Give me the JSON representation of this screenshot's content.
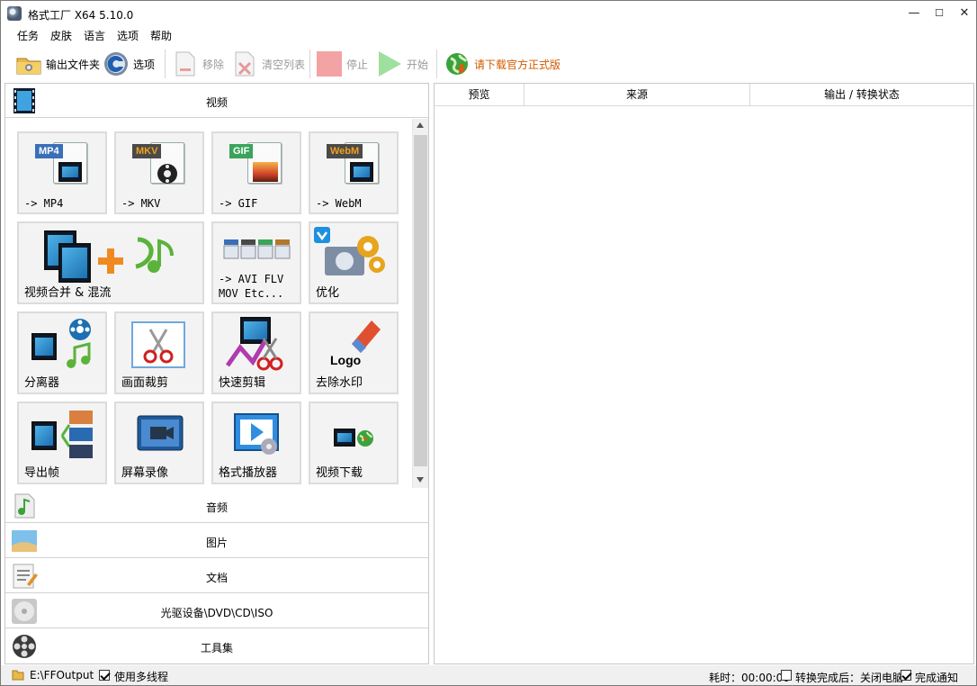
{
  "window": {
    "title": "格式工厂 X64 5.10.0",
    "min": "—",
    "max": "☐",
    "close": "✕"
  },
  "menu": [
    "任务",
    "皮肤",
    "语言",
    "选项",
    "帮助"
  ],
  "toolbar": {
    "output_folder": "输出文件夹",
    "options": "选项",
    "remove": "移除",
    "clear_list": "清空列表",
    "stop": "停止",
    "start": "开始",
    "download_official": "请下载官方正式版",
    "accent": "#d05a00"
  },
  "categories": {
    "video": "视频",
    "audio": "音频",
    "picture": "图片",
    "document": "文档",
    "disc": "光驱设备\\DVD\\CD\\ISO",
    "tools": "工具集"
  },
  "video_tiles": [
    {
      "label": "-> MP4",
      "badge": "MP4",
      "badge_color": "#3a6fb8"
    },
    {
      "label": "-> MKV",
      "badge": "MKV",
      "badge_color": "#4a4a4a"
    },
    {
      "label": "-> GIF",
      "badge": "GIF",
      "badge_color": "#3aa45a"
    },
    {
      "label": "-> WebM",
      "badge": "WebM",
      "badge_color": "#4a4a4a"
    },
    {
      "label": "视频合并 & 混流"
    },
    {
      "label": "-> AVI FLV\nMOV Etc..."
    },
    {
      "label": "优化"
    },
    {
      "label": "分离器"
    },
    {
      "label": "画面裁剪"
    },
    {
      "label": "快速剪辑"
    },
    {
      "label": "去除水印",
      "logo_text": "Logo"
    },
    {
      "label": "导出帧"
    },
    {
      "label": "屏幕录像"
    },
    {
      "label": "格式播放器"
    },
    {
      "label": "视频下载"
    }
  ],
  "table": {
    "columns": [
      "预览",
      "来源",
      "输出 / 转换状态"
    ]
  },
  "status": {
    "output_path": "E:\\FFOutput",
    "multithread": "使用多线程",
    "elapsed": "耗时：00:00:00",
    "shutdown": "转换完成后：关闭电脑",
    "notify": "完成通知"
  }
}
